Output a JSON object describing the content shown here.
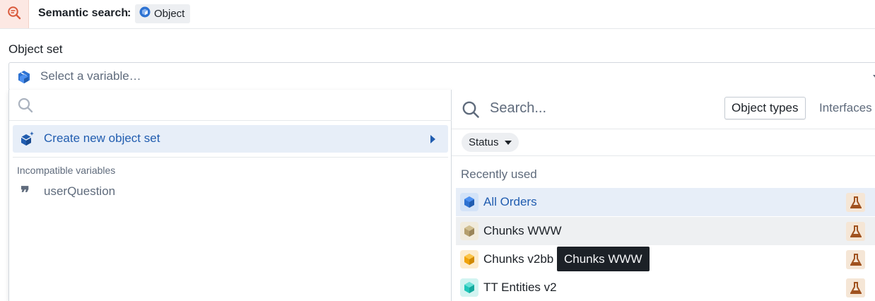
{
  "header": {
    "title": "Semantic search",
    "colon": ":",
    "chip_label": "Object",
    "icon": "search-chat-icon",
    "accent": "#d9593b"
  },
  "field": {
    "label": "Object set",
    "placeholder": "Select a variable…"
  },
  "left_panel": {
    "search_placeholder": "",
    "create_label": "Create new object set",
    "section_incompatible": "Incompatible variables",
    "variables": [
      {
        "icon": "quote-icon",
        "label": "userQuestion"
      }
    ]
  },
  "right_panel": {
    "search_placeholder": "Search...",
    "tabs": [
      {
        "label": "Object types",
        "active": true
      },
      {
        "label": "Interfaces",
        "active": false
      }
    ],
    "filter": {
      "label": "Status"
    },
    "section_recent": "Recently used",
    "results": [
      {
        "label": "All Orders",
        "color": "#2d72d2",
        "bg": "#d3e3f8",
        "state": "selected"
      },
      {
        "label": "Chunks WWW",
        "color": "#b59f6c",
        "bg": "#f1ebdc",
        "state": "hovered"
      },
      {
        "label": "Chunks v2bb",
        "color": "#f0a30a",
        "bg": "#fdeccd",
        "state": "normal"
      },
      {
        "label": "TT Entities v2",
        "color": "#1fc6b9",
        "bg": "#d2f4f1",
        "state": "normal"
      }
    ]
  },
  "tooltip": {
    "text": "Chunks WWW"
  },
  "colors": {
    "primary_text": "#1c2127",
    "muted_text": "#5f6b7c",
    "selected_blue": "#215db0",
    "flask_brown": "#a0521f"
  }
}
